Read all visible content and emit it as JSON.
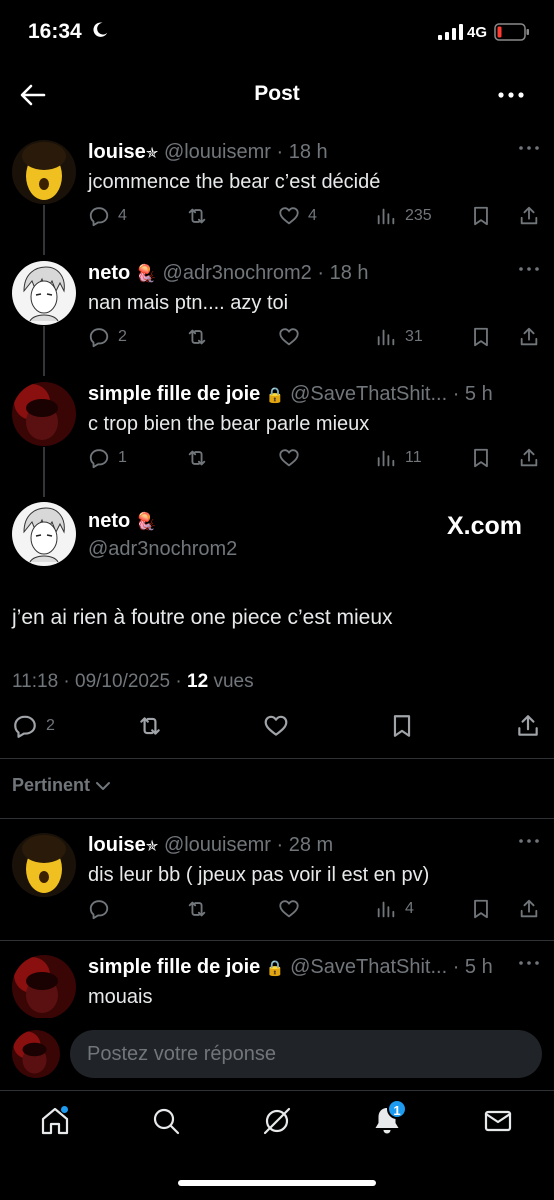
{
  "status_bar": {
    "time": "16:34",
    "network": "4G"
  },
  "header": {
    "title": "Post"
  },
  "thread": [
    {
      "name": "louise",
      "name_suffix": "✯",
      "handle": "@louuisemr",
      "time": "· 18 h",
      "text": "jcommence the bear c’est décidé",
      "replies": "4",
      "reposts": "",
      "likes": "4",
      "views": "235",
      "avatar": "yellow-portrait"
    },
    {
      "name": "neto",
      "name_suffix": "🪼",
      "handle": "@adr3nochrom2",
      "time": "· 18 h",
      "text": "nan mais ptn.... azy toi",
      "replies": "2",
      "reposts": "",
      "likes": "",
      "views": "31",
      "avatar": "anime-white"
    },
    {
      "name": "simple fille de joie",
      "name_suffix": "🔒",
      "handle": "@SaveThatShit...",
      "time": "· 5 h",
      "text": "c trop bien the bear parle mieux",
      "replies": "1",
      "reposts": "",
      "likes": "",
      "views": "11",
      "avatar": "red-portrait"
    }
  ],
  "main_post": {
    "name": "neto",
    "name_suffix": "🪼",
    "handle": "@adr3nochrom2",
    "watermark": "X.com",
    "text": "j’en ai rien à foutre one piece c’est mieux",
    "timestamp": "11:18 · 09/10/2025 ·",
    "views_count": "12",
    "views_label": "vues",
    "replies": "2"
  },
  "sort_label": "Pertinent",
  "replies_list": [
    {
      "name": "louise",
      "name_suffix": "✯",
      "handle": "@louuisemr",
      "time": "· 28 m",
      "text": "dis leur bb ( jpeux pas voir il est en pv)",
      "replies": "",
      "reposts": "",
      "likes": "",
      "views": "4",
      "avatar": "yellow-portrait"
    },
    {
      "name": "simple fille de joie",
      "name_suffix": "🔒",
      "handle": "@SaveThatShit...",
      "time": "· 5 h",
      "text": "mouais",
      "avatar": "red-portrait"
    }
  ],
  "reply_box": {
    "placeholder": "Postez votre réponse"
  },
  "bottom_nav": {
    "notifications_badge": "1"
  },
  "colors": {
    "accent": "#1d9bf0",
    "muted": "#71767b",
    "background": "#000000"
  }
}
